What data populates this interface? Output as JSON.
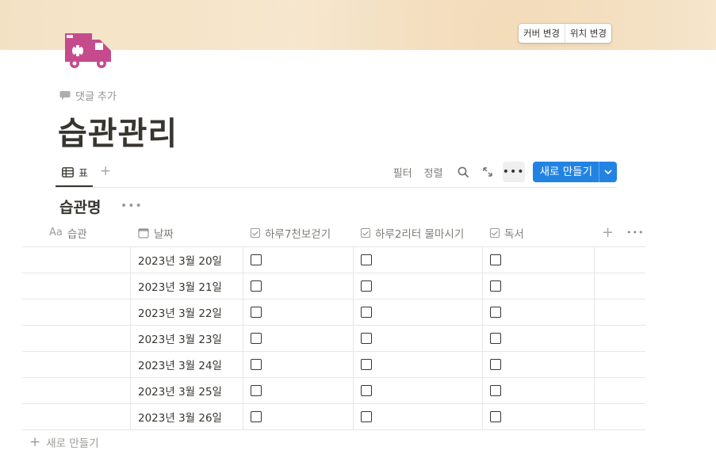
{
  "cover": {
    "change_cover": "커버 변경",
    "reposition": "위치 변경"
  },
  "page": {
    "add_comment": "댓글 추가",
    "title": "습관관리"
  },
  "view": {
    "tab_label": "표",
    "filter": "필터",
    "sort": "정렬",
    "new_button": "새로 만들기"
  },
  "group": {
    "title": "습관명"
  },
  "table": {
    "columns": [
      "습관",
      "날짜",
      "하루7천보걷기",
      "하루2리터 물마시기",
      "독서"
    ],
    "column_icons": [
      "text-type-icon",
      "calendar-icon",
      "checkbox-icon",
      "checkbox-icon",
      "checkbox-icon"
    ],
    "rows": [
      {
        "habit": "",
        "date": "2023년 3월 20일",
        "walk": false,
        "water": false,
        "read": false
      },
      {
        "habit": "",
        "date": "2023년 3월 21일",
        "walk": false,
        "water": false,
        "read": false
      },
      {
        "habit": "",
        "date": "2023년 3월 22일",
        "walk": false,
        "water": false,
        "read": false
      },
      {
        "habit": "",
        "date": "2023년 3월 23일",
        "walk": false,
        "water": false,
        "read": false
      },
      {
        "habit": "",
        "date": "2023년 3월 24일",
        "walk": false,
        "water": false,
        "read": false
      },
      {
        "habit": "",
        "date": "2023년 3월 25일",
        "walk": false,
        "water": false,
        "read": false
      },
      {
        "habit": "",
        "date": "2023년 3월 26일",
        "walk": false,
        "water": false,
        "read": false
      }
    ],
    "add_row_label": "새로 만들기"
  },
  "colors": {
    "accent": "#2383e2",
    "icon": "#c54b8c"
  }
}
